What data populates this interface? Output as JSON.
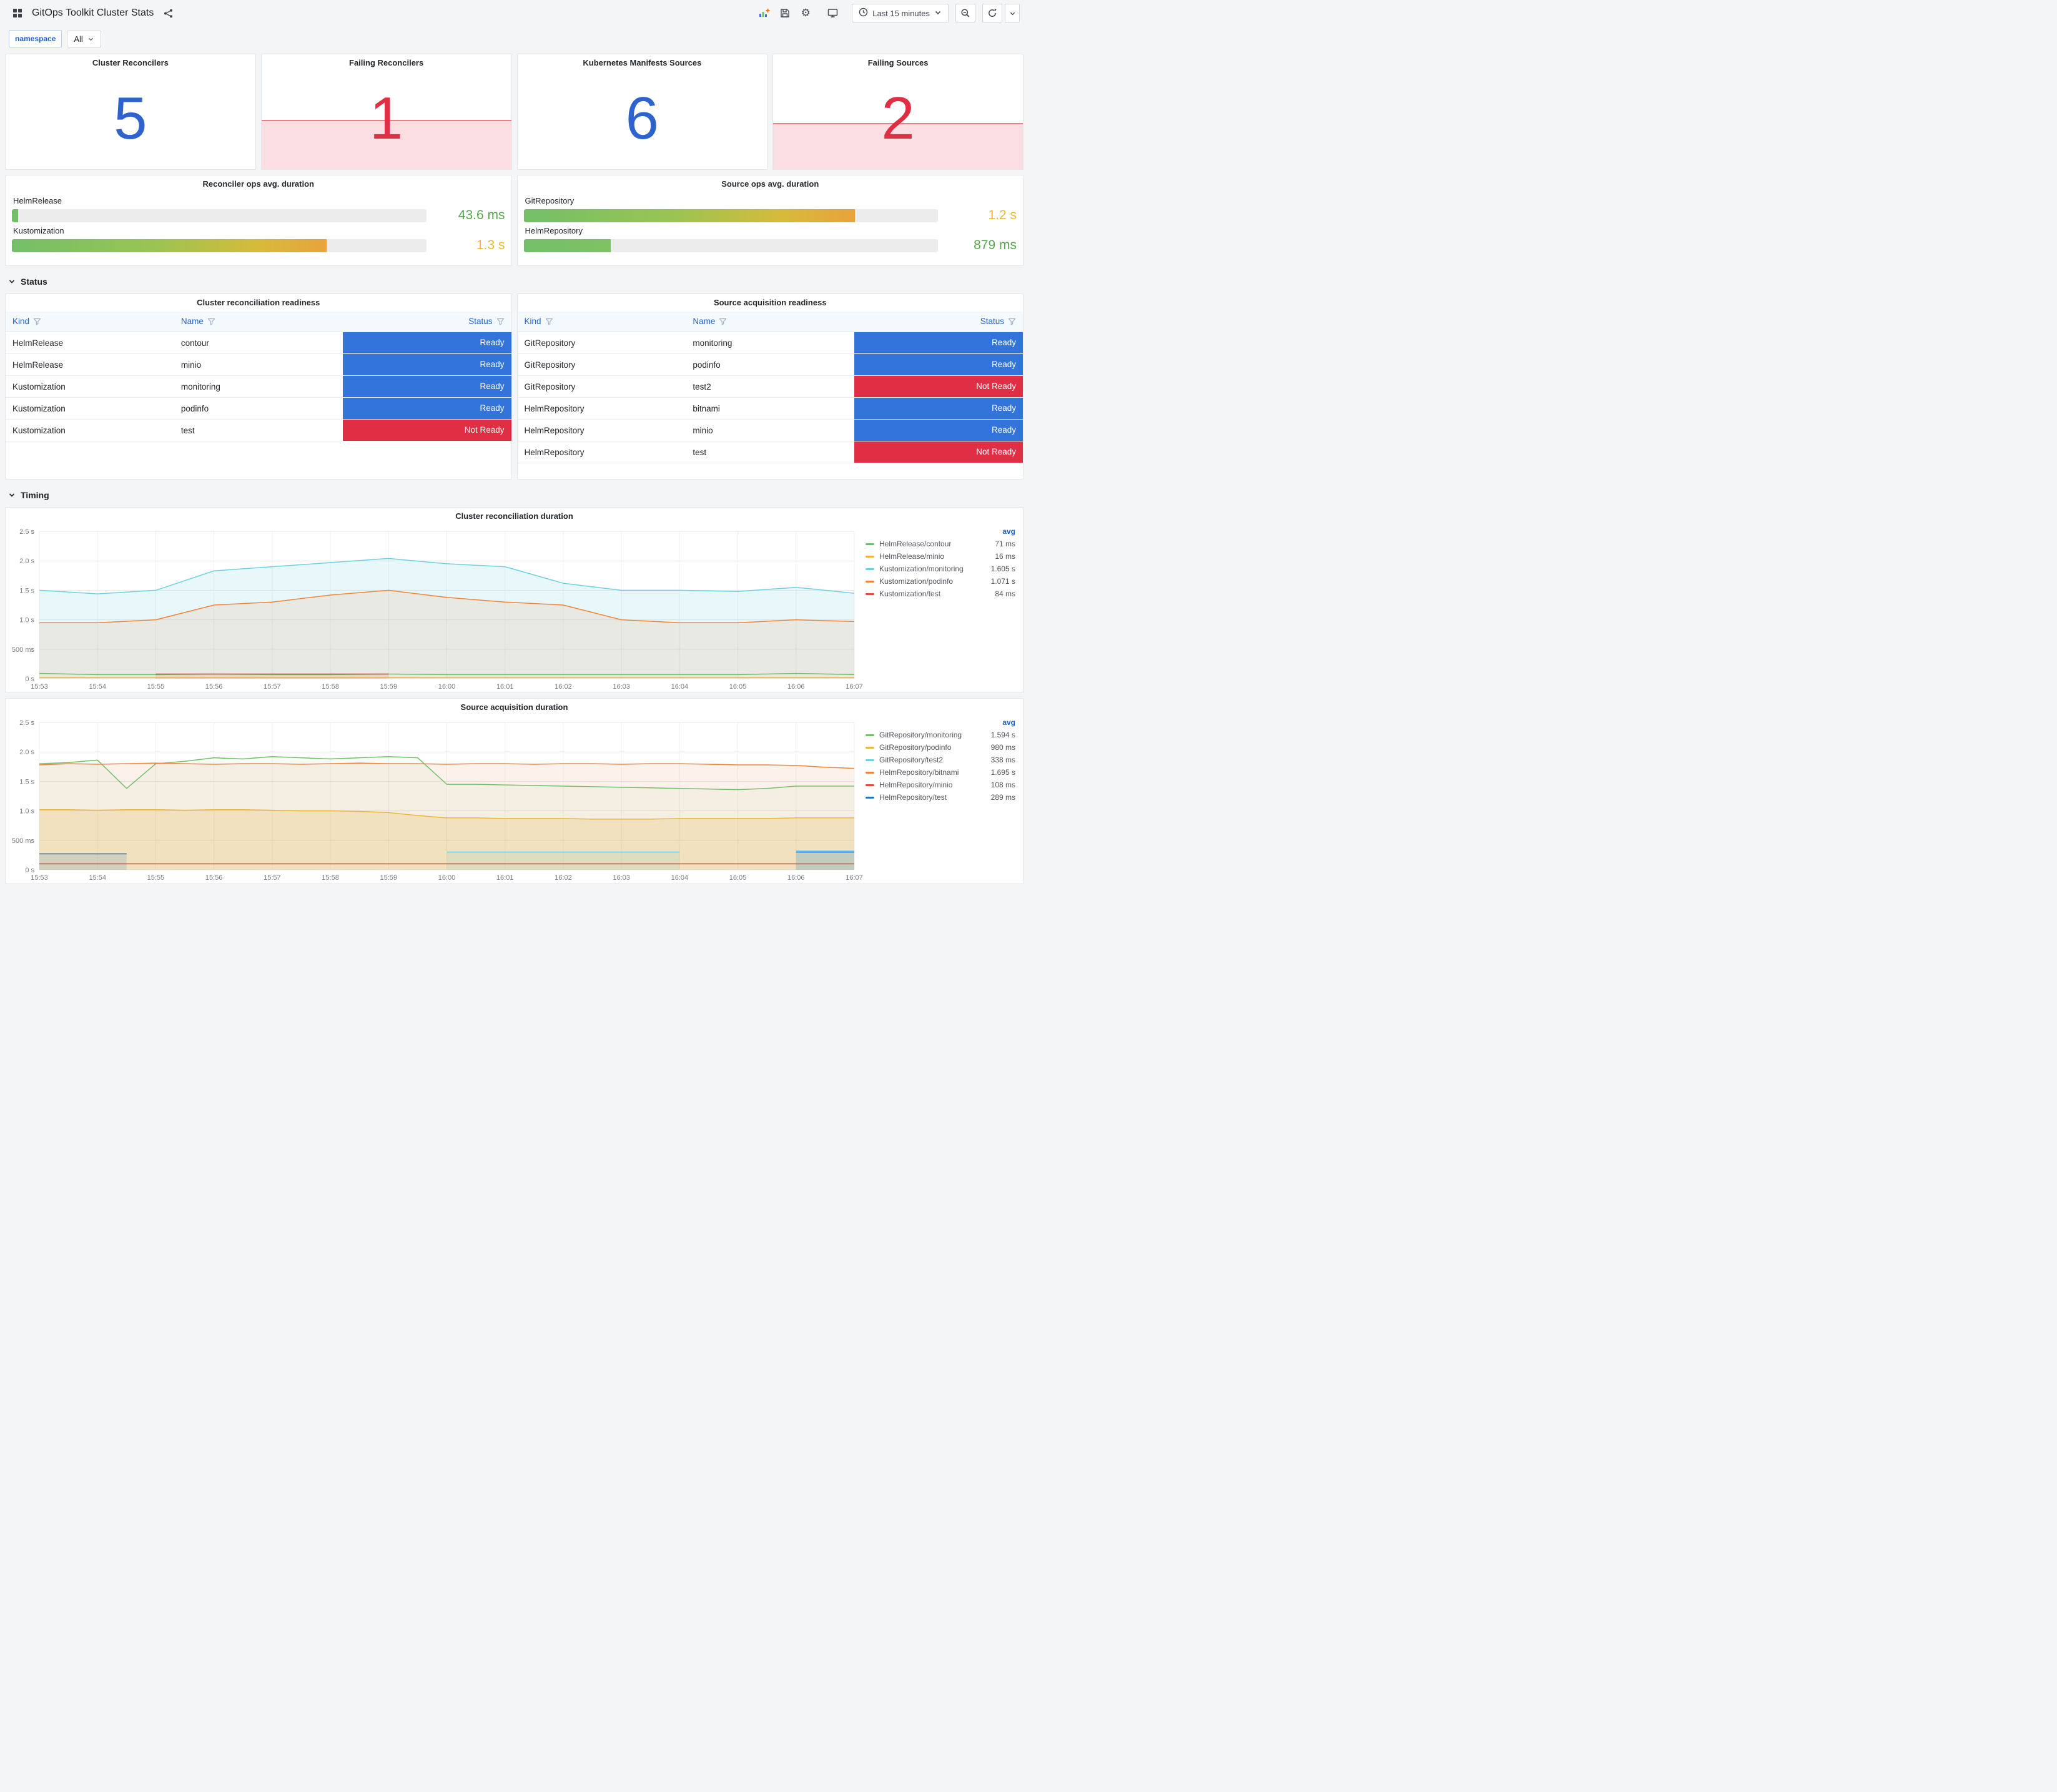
{
  "header": {
    "title": "GitOps Toolkit Cluster Stats",
    "time_range": "Last 15 minutes"
  },
  "icons": {
    "gear": "⚙"
  },
  "variables": {
    "label": "namespace",
    "value": "All"
  },
  "sections": {
    "status": "Status",
    "timing": "Timing"
  },
  "stats": [
    {
      "title": "Cluster Reconcilers",
      "value": "5",
      "color": "#2E63CF",
      "alert": false,
      "fill_pct": 0
    },
    {
      "title": "Failing Reconcilers",
      "value": "1",
      "color": "#E02F44",
      "alert": true,
      "fill_pct": 42
    },
    {
      "title": "Kubernetes Manifests Sources",
      "value": "6",
      "color": "#2E63CF",
      "alert": false,
      "fill_pct": 0
    },
    {
      "title": "Failing Sources",
      "value": "2",
      "color": "#E02F44",
      "alert": true,
      "fill_pct": 39
    }
  ],
  "gauges": [
    {
      "title": "Reconciler ops avg. duration",
      "rows": [
        {
          "label": "HelmRelease",
          "value": "43.6 ms",
          "pct": 1.5,
          "bar": "solid",
          "value_color": "#56A64B"
        },
        {
          "label": "Kustomization",
          "value": "1.3 s",
          "pct": 76,
          "bar": "grad_long",
          "value_color": "#EAB839"
        }
      ]
    },
    {
      "title": "Source ops avg. duration",
      "rows": [
        {
          "label": "GitRepository",
          "value": "1.2 s",
          "pct": 80,
          "bar": "grad_long",
          "value_color": "#EAB839"
        },
        {
          "label": "HelmRepository",
          "value": "879 ms",
          "pct": 21,
          "bar": "grad_short",
          "value_color": "#56A64B"
        }
      ]
    }
  ],
  "status_colors": {
    "Ready": "#3274D9",
    "Not Ready": "#E02F44"
  },
  "tables": [
    {
      "title": "Cluster reconciliation readiness",
      "columns": [
        "Kind",
        "Name",
        "Status"
      ],
      "rows": [
        {
          "kind": "HelmRelease",
          "name": "contour",
          "status": "Ready"
        },
        {
          "kind": "HelmRelease",
          "name": "minio",
          "status": "Ready"
        },
        {
          "kind": "Kustomization",
          "name": "monitoring",
          "status": "Ready"
        },
        {
          "kind": "Kustomization",
          "name": "podinfo",
          "status": "Ready"
        },
        {
          "kind": "Kustomization",
          "name": "test",
          "status": "Not Ready"
        }
      ]
    },
    {
      "title": "Source acquisition readiness",
      "columns": [
        "Kind",
        "Name",
        "Status"
      ],
      "rows": [
        {
          "kind": "GitRepository",
          "name": "monitoring",
          "status": "Ready"
        },
        {
          "kind": "GitRepository",
          "name": "podinfo",
          "status": "Ready"
        },
        {
          "kind": "GitRepository",
          "name": "test2",
          "status": "Not Ready"
        },
        {
          "kind": "HelmRepository",
          "name": "bitnami",
          "status": "Ready"
        },
        {
          "kind": "HelmRepository",
          "name": "minio",
          "status": "Ready"
        },
        {
          "kind": "HelmRepository",
          "name": "test",
          "status": "Not Ready"
        }
      ]
    }
  ],
  "chart_data": [
    {
      "type": "line",
      "title": "Cluster reconciliation duration",
      "ylim": [
        0,
        2.5
      ],
      "grid": true,
      "legend_position": "right",
      "legend_header": "avg",
      "yticks": [
        {
          "v": 0,
          "label": "0 s"
        },
        {
          "v": 0.5,
          "label": "500 ms"
        },
        {
          "v": 1,
          "label": "1.0 s"
        },
        {
          "v": 1.5,
          "label": "1.5 s"
        },
        {
          "v": 2,
          "label": "2.0 s"
        },
        {
          "v": 2.5,
          "label": "2.5 s"
        }
      ],
      "x_labels": [
        "15:53",
        "15:54",
        "15:55",
        "15:56",
        "15:57",
        "15:58",
        "15:59",
        "16:00",
        "16:01",
        "16:02",
        "16:03",
        "16:04",
        "16:05",
        "16:06",
        "16:07"
      ],
      "series": [
        {
          "name": "HelmRelease/contour",
          "color": "#73BF69",
          "avg": "71 ms",
          "fill": 0,
          "values": [
            0.09,
            0.07,
            0.07,
            0.08,
            0.07,
            0.07,
            0.08,
            0.07,
            0.07,
            0.07,
            0.07,
            0.07,
            0.07,
            0.09,
            0.07
          ]
        },
        {
          "name": "HelmRelease/minio",
          "color": "#EAB839",
          "avg": "16 ms",
          "fill": 0,
          "values": [
            0.02,
            0.02,
            0.02,
            0.02,
            0.02,
            0.02,
            0.02,
            0.02,
            0.02,
            0.02,
            0.02,
            0.02,
            0.02,
            0.02,
            0.02
          ]
        },
        {
          "name": "Kustomization/monitoring",
          "color": "#6ED0E0",
          "avg": "1.605 s",
          "fill": 0.16,
          "values": [
            1.5,
            1.44,
            1.5,
            1.83,
            1.9,
            1.97,
            2.04,
            1.95,
            1.9,
            1.62,
            1.5,
            1.5,
            1.48,
            1.55,
            1.45
          ]
        },
        {
          "name": "Kustomization/podinfo",
          "color": "#EF843C",
          "avg": "1.071 s",
          "fill": 0.12,
          "values": [
            0.95,
            0.95,
            1.0,
            1.25,
            1.3,
            1.42,
            1.5,
            1.38,
            1.3,
            1.25,
            1.0,
            0.95,
            0.95,
            1.0,
            0.97
          ]
        },
        {
          "name": "Kustomization/test",
          "color": "#E24D42",
          "avg": "84 ms",
          "fill": 0.12,
          "values": [
            null,
            null,
            0.08,
            0.08,
            0.08,
            0.08,
            0.08,
            null,
            null,
            null,
            null,
            null,
            null,
            null,
            null
          ]
        }
      ]
    },
    {
      "type": "line",
      "title": "Source acquisition duration",
      "ylim": [
        0,
        2.5
      ],
      "grid": true,
      "legend_position": "right",
      "legend_header": "avg",
      "yticks": [
        {
          "v": 0,
          "label": "0 s"
        },
        {
          "v": 0.5,
          "label": "500 ms"
        },
        {
          "v": 1,
          "label": "1.0 s"
        },
        {
          "v": 1.5,
          "label": "1.5 s"
        },
        {
          "v": 2,
          "label": "2.0 s"
        },
        {
          "v": 2.5,
          "label": "2.5 s"
        }
      ],
      "x_labels": [
        "15:53",
        "15:54",
        "15:55",
        "15:56",
        "15:57",
        "15:58",
        "15:59",
        "16:00",
        "16:01",
        "16:02",
        "16:03",
        "16:04",
        "16:05",
        "16:06",
        "16:07"
      ],
      "series": [
        {
          "name": "GitRepository/monitoring",
          "color": "#73BF69",
          "avg": "1.594 s",
          "fill": 0.06,
          "values": [
            1.8,
            1.82,
            1.86,
            1.38,
            1.8,
            1.84,
            1.9,
            1.88,
            1.92,
            1.9,
            1.88,
            1.9,
            1.92,
            1.9,
            1.45,
            1.45,
            1.44,
            1.43,
            1.42,
            1.41,
            1.4,
            1.39,
            1.38,
            1.37,
            1.36,
            1.38,
            1.42,
            1.42,
            1.42
          ]
        },
        {
          "name": "GitRepository/podinfo",
          "color": "#EAB839",
          "avg": "980 ms",
          "fill": 0.22,
          "values": [
            1.02,
            1.02,
            1.01,
            1.02,
            1.02,
            1.01,
            1.02,
            1.02,
            1.01,
            1.0,
            1.0,
            0.99,
            0.97,
            0.92,
            0.88,
            0.88,
            0.87,
            0.87,
            0.87,
            0.86,
            0.86,
            0.86,
            0.87,
            0.87,
            0.87,
            0.87,
            0.88,
            0.88,
            0.88
          ]
        },
        {
          "name": "GitRepository/test2",
          "color": "#6ED0E0",
          "avg": "338 ms",
          "fill": 0.15,
          "values": [
            null,
            null,
            null,
            null,
            null,
            null,
            null,
            null,
            null,
            null,
            null,
            null,
            null,
            null,
            0.3,
            0.3,
            0.3,
            0.3,
            0.3,
            0.3,
            0.3,
            0.3,
            0.3,
            null,
            null,
            null,
            0.32,
            0.32,
            0.32
          ]
        },
        {
          "name": "HelmRepository/bitnami",
          "color": "#EF843C",
          "avg": "1.695 s",
          "fill": 0.1,
          "values": [
            1.78,
            1.8,
            1.79,
            1.8,
            1.81,
            1.8,
            1.79,
            1.8,
            1.8,
            1.79,
            1.8,
            1.81,
            1.8,
            1.8,
            1.79,
            1.8,
            1.8,
            1.79,
            1.8,
            1.8,
            1.79,
            1.8,
            1.8,
            1.79,
            1.78,
            1.78,
            1.77,
            1.74,
            1.72
          ]
        },
        {
          "name": "HelmRepository/minio",
          "color": "#E24D42",
          "avg": "108 ms",
          "fill": 0,
          "values": [
            0.1,
            0.1,
            0.1,
            0.1,
            0.1,
            0.1,
            0.1,
            0.1,
            0.1,
            0.1,
            0.1,
            0.1,
            0.1,
            0.1,
            0.1,
            0.1,
            0.1,
            0.1,
            0.1,
            0.1,
            0.1,
            0.1,
            0.1,
            0.1,
            0.1,
            0.1,
            0.1,
            0.1,
            0.1
          ]
        },
        {
          "name": "HelmRepository/test",
          "color": "#1F78C1",
          "avg": "289 ms",
          "fill": 0.15,
          "values": [
            0.27,
            0.27,
            0.27,
            0.27,
            null,
            null,
            null,
            null,
            null,
            null,
            null,
            null,
            null,
            null,
            null,
            null,
            null,
            null,
            null,
            null,
            null,
            null,
            null,
            null,
            null,
            null,
            0.3,
            0.3,
            0.3
          ]
        }
      ]
    }
  ]
}
